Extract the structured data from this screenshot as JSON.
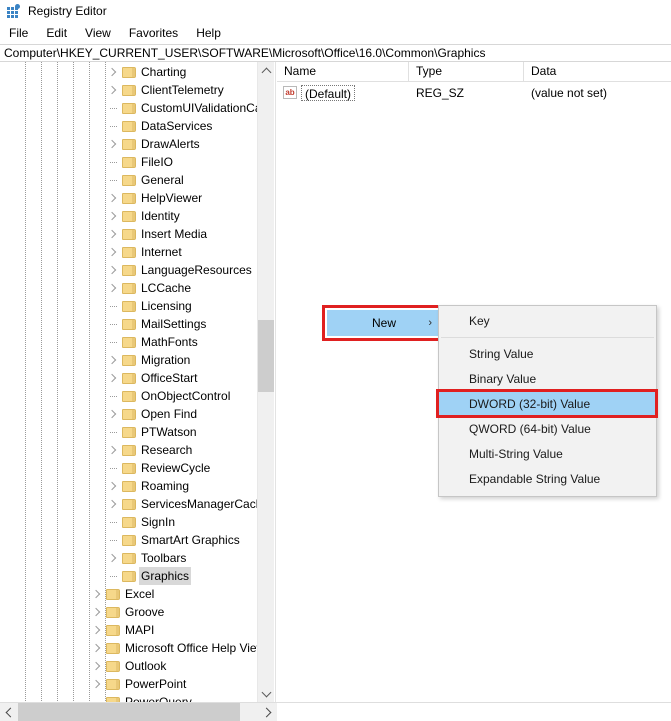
{
  "window": {
    "title": "Registry Editor",
    "icon": "registry-editor-icon"
  },
  "menubar": {
    "items": [
      {
        "label": "File"
      },
      {
        "label": "Edit"
      },
      {
        "label": "View"
      },
      {
        "label": "Favorites"
      },
      {
        "label": "Help"
      }
    ]
  },
  "address": {
    "path": "Computer\\HKEY_CURRENT_USER\\SOFTWARE\\Microsoft\\Office\\16.0\\Common\\Graphics"
  },
  "tree": {
    "items": [
      {
        "label": "Charting",
        "depth": 6,
        "expandable": true,
        "selected": false
      },
      {
        "label": "ClientTelemetry",
        "depth": 6,
        "expandable": true,
        "selected": false
      },
      {
        "label": "CustomUIValidationCac",
        "depth": 6,
        "expandable": false,
        "selected": false
      },
      {
        "label": "DataServices",
        "depth": 6,
        "expandable": false,
        "selected": false
      },
      {
        "label": "DrawAlerts",
        "depth": 6,
        "expandable": true,
        "selected": false
      },
      {
        "label": "FileIO",
        "depth": 6,
        "expandable": false,
        "selected": false
      },
      {
        "label": "General",
        "depth": 6,
        "expandable": false,
        "selected": false
      },
      {
        "label": "HelpViewer",
        "depth": 6,
        "expandable": true,
        "selected": false
      },
      {
        "label": "Identity",
        "depth": 6,
        "expandable": true,
        "selected": false
      },
      {
        "label": "Insert Media",
        "depth": 6,
        "expandable": true,
        "selected": false
      },
      {
        "label": "Internet",
        "depth": 6,
        "expandable": true,
        "selected": false
      },
      {
        "label": "LanguageResources",
        "depth": 6,
        "expandable": true,
        "selected": false
      },
      {
        "label": "LCCache",
        "depth": 6,
        "expandable": true,
        "selected": false
      },
      {
        "label": "Licensing",
        "depth": 6,
        "expandable": false,
        "selected": false
      },
      {
        "label": "MailSettings",
        "depth": 6,
        "expandable": false,
        "selected": false
      },
      {
        "label": "MathFonts",
        "depth": 6,
        "expandable": false,
        "selected": false
      },
      {
        "label": "Migration",
        "depth": 6,
        "expandable": true,
        "selected": false
      },
      {
        "label": "OfficeStart",
        "depth": 6,
        "expandable": true,
        "selected": false
      },
      {
        "label": "OnObjectControl",
        "depth": 6,
        "expandable": false,
        "selected": false
      },
      {
        "label": "Open Find",
        "depth": 6,
        "expandable": true,
        "selected": false
      },
      {
        "label": "PTWatson",
        "depth": 6,
        "expandable": false,
        "selected": false
      },
      {
        "label": "Research",
        "depth": 6,
        "expandable": true,
        "selected": false
      },
      {
        "label": "ReviewCycle",
        "depth": 6,
        "expandable": false,
        "selected": false
      },
      {
        "label": "Roaming",
        "depth": 6,
        "expandable": true,
        "selected": false
      },
      {
        "label": "ServicesManagerCache",
        "depth": 6,
        "expandable": true,
        "selected": false
      },
      {
        "label": "SignIn",
        "depth": 6,
        "expandable": false,
        "selected": false
      },
      {
        "label": "SmartArt Graphics",
        "depth": 6,
        "expandable": false,
        "selected": false
      },
      {
        "label": "Toolbars",
        "depth": 6,
        "expandable": true,
        "selected": false
      },
      {
        "label": "Graphics",
        "depth": 6,
        "expandable": false,
        "selected": true
      },
      {
        "label": "Excel",
        "depth": 5,
        "expandable": true,
        "selected": false
      },
      {
        "label": "Groove",
        "depth": 5,
        "expandable": true,
        "selected": false
      },
      {
        "label": "MAPI",
        "depth": 5,
        "expandable": true,
        "selected": false
      },
      {
        "label": "Microsoft Office Help View",
        "depth": 5,
        "expandable": true,
        "selected": false
      },
      {
        "label": "Outlook",
        "depth": 5,
        "expandable": true,
        "selected": false
      },
      {
        "label": "PowerPoint",
        "depth": 5,
        "expandable": true,
        "selected": false
      },
      {
        "label": "PowerQuery",
        "depth": 5,
        "expandable": false,
        "selected": false
      }
    ],
    "scrollbar": {
      "up_icon": "chevron-up-icon",
      "down_icon": "chevron-down-icon"
    }
  },
  "values": {
    "columns": [
      "Name",
      "Type",
      "Data"
    ],
    "rows": [
      {
        "icon": "ab",
        "name": "(Default)",
        "type": "REG_SZ",
        "data": "(value not set)"
      }
    ]
  },
  "context_menu": {
    "new_label": "New",
    "submenu_arrow": "›",
    "highlight_color": "#9fd2f5",
    "annotation_color": "#e02020",
    "submenu": [
      {
        "label": "Key",
        "highlighted": false,
        "separator_after": true
      },
      {
        "label": "String Value",
        "highlighted": false,
        "separator_after": false
      },
      {
        "label": "Binary Value",
        "highlighted": false,
        "separator_after": false
      },
      {
        "label": "DWORD (32-bit) Value",
        "highlighted": true,
        "separator_after": false
      },
      {
        "label": "QWORD (64-bit) Value",
        "highlighted": false,
        "separator_after": false
      },
      {
        "label": "Multi-String Value",
        "highlighted": false,
        "separator_after": false
      },
      {
        "label": "Expandable String Value",
        "highlighted": false,
        "separator_after": false
      }
    ]
  },
  "bottom_scrollbar": {
    "left_icon": "chevron-left-icon",
    "right_icon": "chevron-right-icon"
  }
}
